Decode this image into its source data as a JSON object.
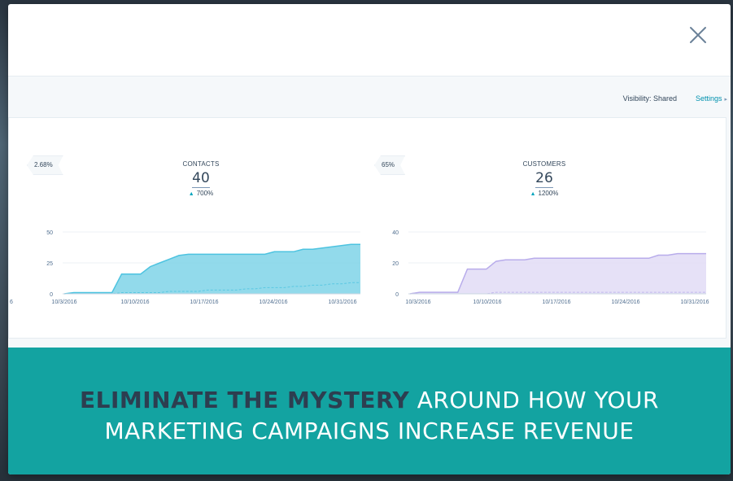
{
  "toolbar": {
    "visibility": "Visibility:  Shared",
    "settings": "Settings"
  },
  "panels": [
    {
      "flag": "2.68%",
      "label": "CONTACTS",
      "value": "40",
      "change": "700%",
      "color": "#7fd3e8",
      "line_color": "#4dc3e0"
    },
    {
      "flag": "65%",
      "label": "CUSTOMERS",
      "value": "26",
      "change": "1200%",
      "color": "#e2dcf6",
      "line_color": "#b8aceb"
    }
  ],
  "chart_data": [
    {
      "type": "area",
      "title": "CONTACTS",
      "x": [
        "10/3/2016",
        "10/10/2016",
        "10/17/2016",
        "10/24/2016",
        "10/31/2016"
      ],
      "y_ticks": [
        0,
        25,
        50
      ],
      "ylim": [
        0,
        50
      ],
      "left_clip_label": "6",
      "series": [
        {
          "values": [
            0,
            1,
            1,
            1,
            1,
            1,
            16,
            16,
            16,
            22,
            25,
            28,
            31,
            32,
            32,
            32,
            32,
            32,
            32,
            32,
            32,
            32,
            34,
            34,
            34,
            36,
            36,
            37,
            38,
            39,
            40,
            40
          ]
        },
        {
          "values": [
            0,
            0,
            0,
            0,
            0,
            0,
            1,
            1,
            1,
            1,
            1,
            2,
            2,
            2,
            2,
            3,
            3,
            3,
            3,
            4,
            4,
            5,
            5,
            5,
            6,
            6,
            7,
            7,
            8,
            8,
            9,
            9
          ]
        }
      ]
    },
    {
      "type": "area",
      "title": "CUSTOMERS",
      "x": [
        "10/3/2016",
        "10/10/2016",
        "10/17/2016",
        "10/24/2016",
        "10/31/2016"
      ],
      "y_ticks": [
        0,
        20,
        40
      ],
      "ylim": [
        0,
        40
      ],
      "series": [
        {
          "values": [
            0,
            1,
            1,
            1,
            1,
            1,
            16,
            16,
            16,
            21,
            22,
            22,
            22,
            23,
            23,
            23,
            23,
            23,
            23,
            23,
            23,
            23,
            23,
            23,
            23,
            23,
            25,
            25,
            26,
            26,
            26,
            26
          ]
        },
        {
          "values": [
            0,
            0,
            0,
            0,
            0,
            0,
            0,
            0,
            0,
            1,
            1,
            1,
            1,
            1,
            1,
            1,
            1,
            1,
            1,
            1,
            1,
            1,
            1,
            1,
            1,
            1,
            1,
            1,
            1,
            1,
            1,
            1
          ]
        }
      ]
    }
  ],
  "banner": {
    "headline_em": "ELIMINATE THE MYSTERY",
    "headline_rest_1": " AROUND HOW YOUR",
    "headline_line_2": "MARKETING CAMPAIGNS INCREASE REVENUE",
    "background": "#13a3a1"
  },
  "close_icon": "close-icon"
}
